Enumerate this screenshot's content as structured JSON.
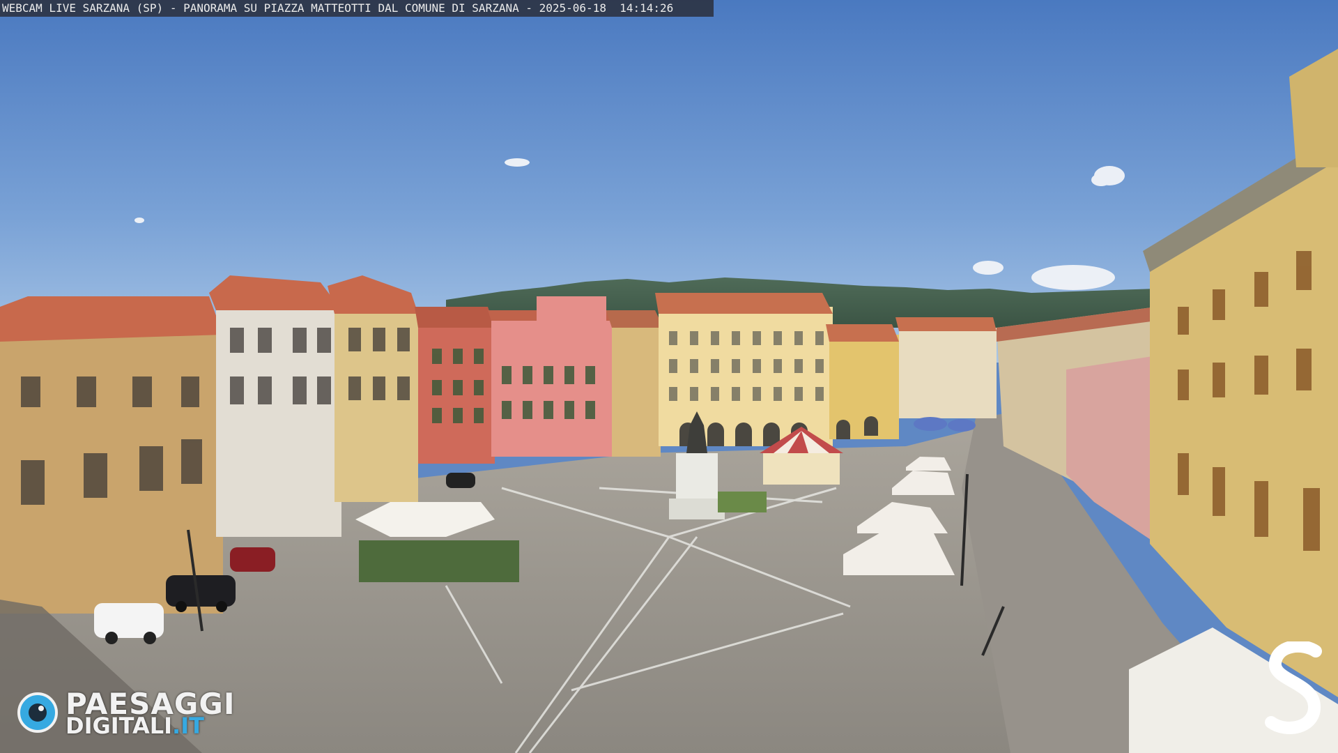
{
  "caption": {
    "text": "WEBCAM LIVE SARZANA (SP) - PANORAMA SU PIAZZA MATTEOTTI DAL COMUNE DI SARZANA - 2025-06-18  14:14:26"
  },
  "logo": {
    "line1": "PAESAGGI",
    "line2_main": "DIGITALI",
    "line2_tld": ".IT",
    "icon": "eye-icon",
    "accent_color": "#36a9e1"
  },
  "corner_mark": {
    "icon": "s-logo-icon",
    "color": "#ffffff"
  },
  "colors": {
    "sky_top": "#4f7fc4",
    "sky_bottom": "#9cbde2",
    "piazza_ground": "#9a9690",
    "paving_lines": "#e6e6e2"
  }
}
